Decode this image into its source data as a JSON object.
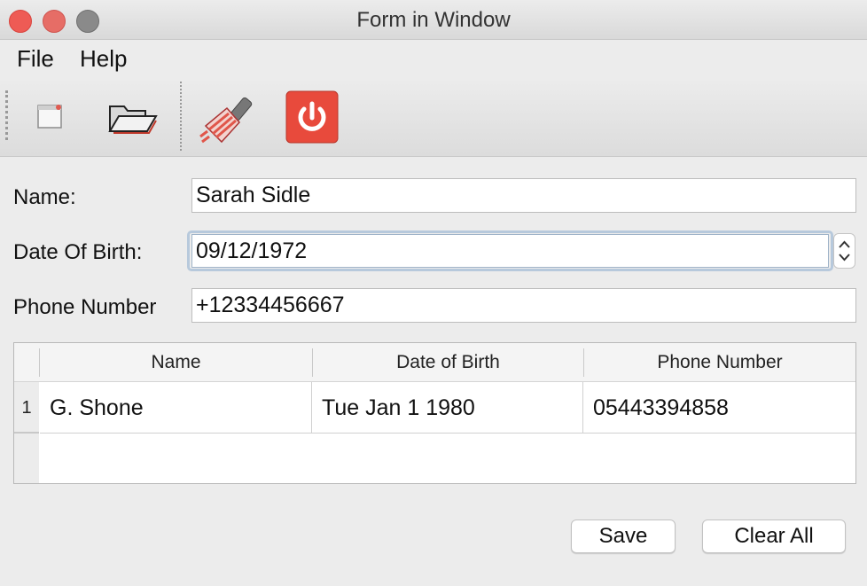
{
  "window": {
    "title": "Form in Window",
    "traffic_lights": {
      "close": "#ee5b55",
      "minimize": "#e66d66",
      "zoom": "#8a8a8a"
    }
  },
  "menu": {
    "items": [
      "File",
      "Help"
    ]
  },
  "toolbar": {
    "buttons": [
      {
        "icon": "new-window-icon"
      },
      {
        "icon": "open-folder-icon"
      },
      {
        "icon": "clear-brush-icon"
      },
      {
        "icon": "power-icon",
        "color": "#e84a3c"
      }
    ]
  },
  "form": {
    "name_label": "Name:",
    "name_value": "Sarah Sidle",
    "dob_label": "Date Of Birth:",
    "dob_value": "09/12/1972",
    "phone_label": "Phone Number",
    "phone_value": "+12334456667"
  },
  "table": {
    "columns": [
      "Name",
      "Date of Birth",
      "Phone Number"
    ],
    "rows": [
      {
        "index": "1",
        "name": "G. Shone",
        "dob": "Tue Jan 1 1980",
        "phone": "05443394858"
      }
    ]
  },
  "actions": {
    "save_label": "Save",
    "clear_label": "Clear All"
  }
}
